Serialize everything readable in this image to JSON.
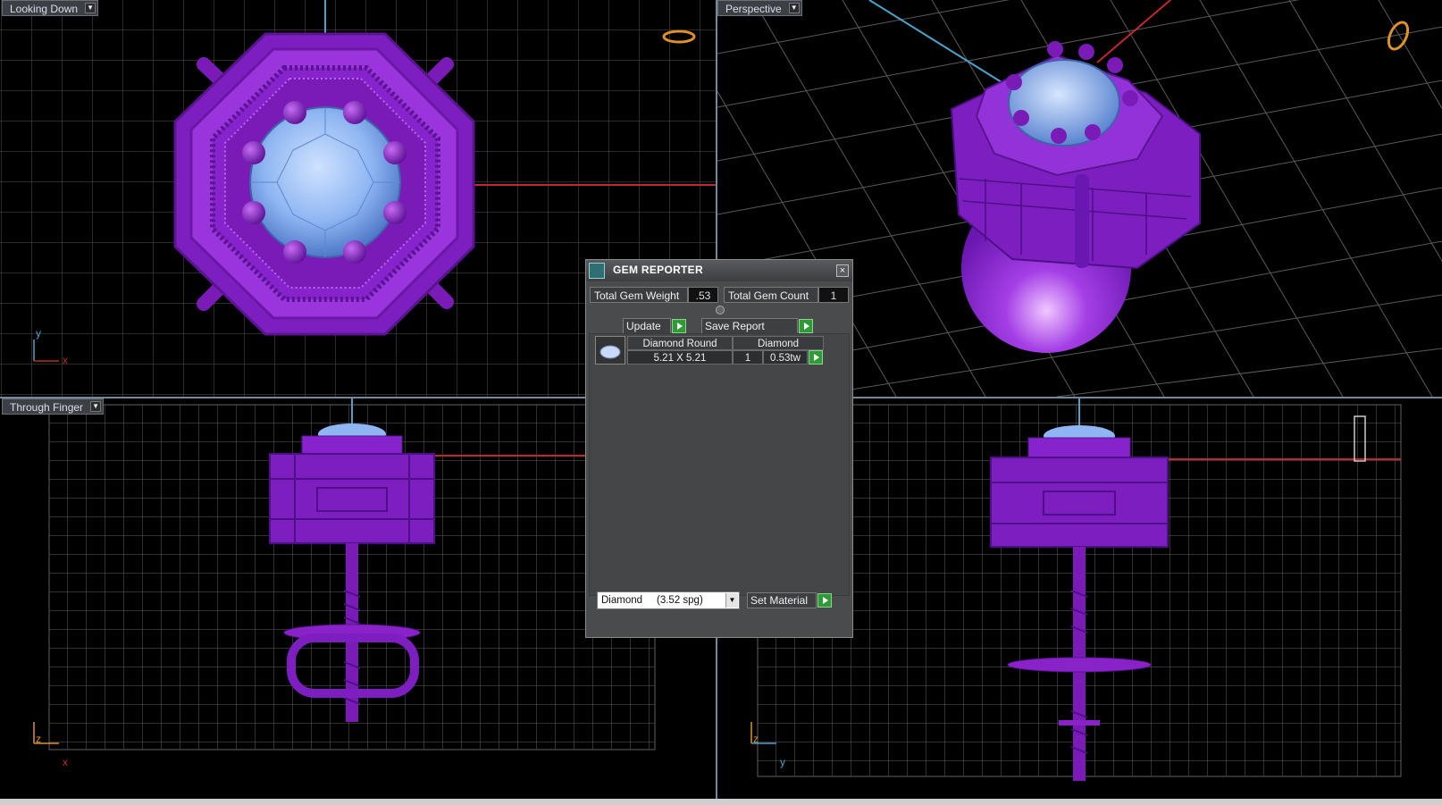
{
  "viewports": {
    "top_left": {
      "label": "Looking Down",
      "axes": [
        "y",
        "x"
      ]
    },
    "top_right": {
      "label": "Perspective"
    },
    "bottom_left": {
      "label": "Through Finger",
      "axes": [
        "z",
        "x"
      ]
    },
    "bottom_right": {
      "label": "",
      "axes": [
        "z",
        "y"
      ]
    }
  },
  "dialog": {
    "title": "GEM REPORTER",
    "close_glyph": "×",
    "total_weight_label": "Total Gem Weight",
    "total_weight_value": ".53",
    "total_count_label": "Total Gem Count",
    "total_count_value": "1",
    "update_label": "Update",
    "save_report_label": "Save Report",
    "gems": [
      {
        "shape": "Diamond Round",
        "material": "Diamond",
        "size": "5.21 X 5.21",
        "count": "1",
        "weight": "0.53tw"
      }
    ],
    "material_select": "Diamond     (3.52 spg)",
    "set_material_label": "Set Material"
  },
  "colors": {
    "metal": "#8a22c9",
    "gem": "#8fb6f2",
    "grid": "#5a5a5a",
    "x_axis": "#c0292b",
    "y_axis": "#4aa3c9",
    "go_button": "#2f9b35"
  }
}
